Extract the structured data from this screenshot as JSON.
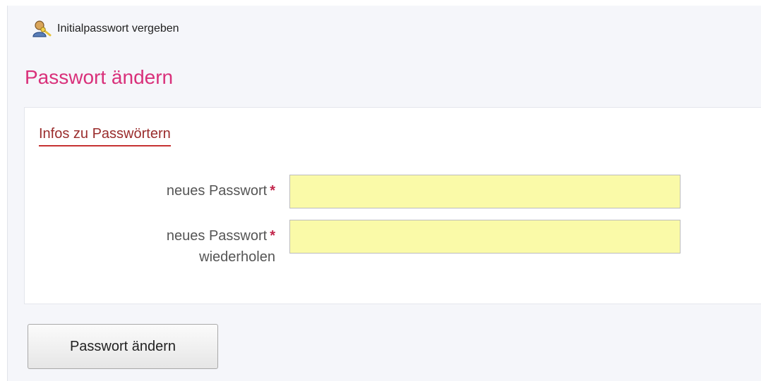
{
  "breadcrumb": {
    "icon": "user-key-icon",
    "label": "Initialpasswort vergeben"
  },
  "page_title": "Passwort ändern",
  "form": {
    "info_link": "Infos zu Passwörtern",
    "fields": [
      {
        "label": "neues Passwort",
        "label_line2": "",
        "required_mark": "*",
        "value": ""
      },
      {
        "label": "neues Passwort",
        "label_line2": "wiederholen",
        "required_mark": "*",
        "value": ""
      }
    ]
  },
  "submit_label": "Passwort ändern",
  "colors": {
    "title": "#d9307a",
    "link": "#9a2c2c",
    "input_bg": "#fafaa8",
    "required": "#c2264b"
  }
}
